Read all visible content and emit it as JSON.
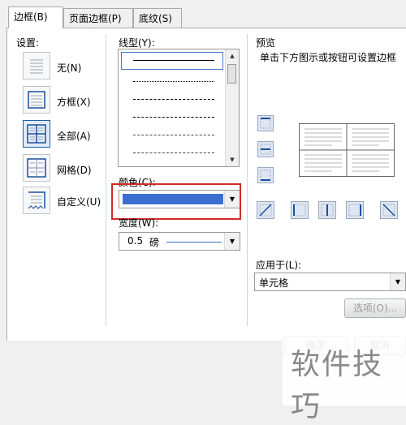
{
  "tabs": [
    {
      "label": "边框(B)",
      "active": true
    },
    {
      "label": "页面边框(P)",
      "active": false
    },
    {
      "label": "底纹(S)",
      "active": false
    }
  ],
  "settings": {
    "heading": "设置:",
    "items": [
      {
        "label": "无(N)",
        "icon": "border-none-icon",
        "selected": false
      },
      {
        "label": "方框(X)",
        "icon": "border-box-icon",
        "selected": false
      },
      {
        "label": "全部(A)",
        "icon": "border-all-icon",
        "selected": true
      },
      {
        "label": "网格(D)",
        "icon": "border-grid-icon",
        "selected": false
      },
      {
        "label": "自定义(U)",
        "icon": "border-custom-icon",
        "selected": false
      }
    ]
  },
  "style": {
    "line_label": "线型(Y):",
    "line_styles": [
      "solid",
      "dotted",
      "dashed-small",
      "dashed",
      "dash-dot",
      "dash-dot-dot"
    ],
    "color_label": "颜色(C):",
    "color_value": "#3a6fd0",
    "width_label": "宽度(W):",
    "width_value": "0.5",
    "width_unit": "磅"
  },
  "preview": {
    "heading": "预览",
    "hint": "单击下方图示或按钮可设置边框"
  },
  "apply_to": {
    "label": "应用于(L):",
    "value": "单元格"
  },
  "buttons": {
    "options": "选项(O)...",
    "ok": "确定",
    "cancel": "取消"
  },
  "watermark": "软件技巧",
  "colors": {
    "highlight": "#d32a2a",
    "selected_border": "#1c5fb0"
  }
}
